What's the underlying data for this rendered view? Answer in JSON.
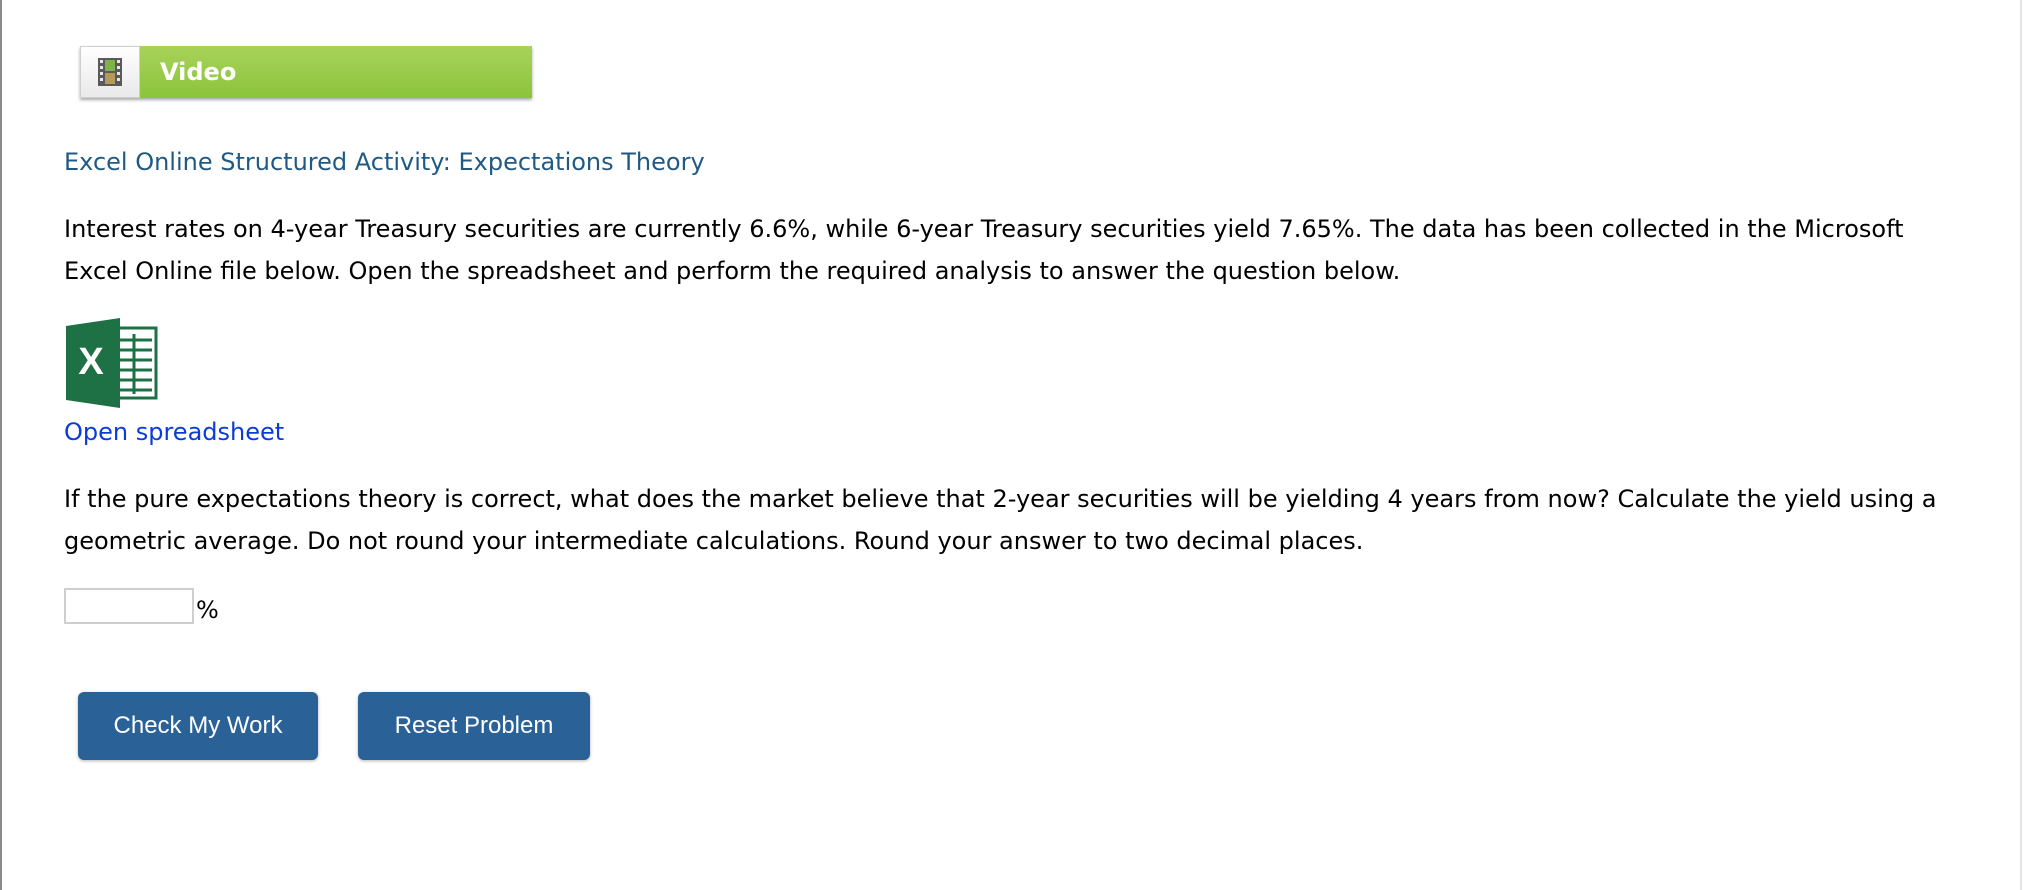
{
  "video": {
    "label": "Video",
    "icon": "film-icon"
  },
  "activity": {
    "title": "Excel Online Structured Activity: Expectations Theory",
    "intro": "Interest rates on 4-year Treasury securities are currently 6.6%, while 6-year Treasury securities yield 7.65%. The data has been collected in the Microsoft Excel Online file below. Open the spreadsheet and perform the required analysis to answer the question below.",
    "spreadsheet_icon": "excel-icon",
    "spreadsheet_link": "Open spreadsheet",
    "question": "If the pure expectations theory is correct, what does the market believe that 2-year securities will be yielding 4 years from now? Calculate the yield using a geometric average. Do not round your intermediate calculations. Round your answer to two decimal places.",
    "answer_value": "",
    "answer_unit": "%"
  },
  "buttons": {
    "check": "Check My Work",
    "reset": "Reset Problem"
  },
  "colors": {
    "video_green": "#8cc43c",
    "title_blue": "#1f5a85",
    "link_blue": "#0b3cd8",
    "button_blue": "#2a6298",
    "excel_green": "#1e7145"
  }
}
